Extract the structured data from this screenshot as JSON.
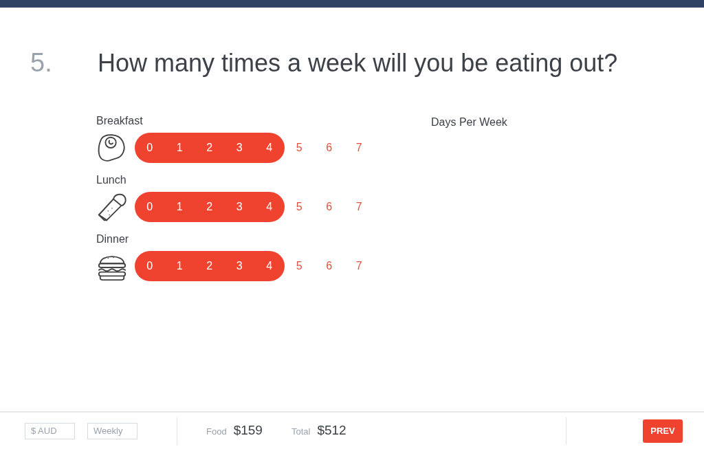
{
  "question": {
    "number": "5.",
    "text": "How many times a week will you be eating out?"
  },
  "column_heading": "Days Per Week",
  "meals": [
    {
      "kind": "egg",
      "label": "Breakfast",
      "options": [
        {
          "label": "0",
          "selected": false
        },
        {
          "label": "1",
          "selected": false
        },
        {
          "label": "2",
          "selected": false
        },
        {
          "label": "3",
          "selected": false
        },
        {
          "label": "4",
          "selected": true
        },
        {
          "label": "5",
          "selected": false
        },
        {
          "label": "6",
          "selected": false
        },
        {
          "label": "7",
          "selected": false
        }
      ]
    },
    {
      "kind": "burrito",
      "label": "Lunch",
      "options": [
        {
          "label": "0",
          "selected": false
        },
        {
          "label": "1",
          "selected": false
        },
        {
          "label": "2",
          "selected": false
        },
        {
          "label": "3",
          "selected": false
        },
        {
          "label": "4",
          "selected": true
        },
        {
          "label": "5",
          "selected": false
        },
        {
          "label": "6",
          "selected": false
        },
        {
          "label": "7",
          "selected": false
        }
      ]
    },
    {
      "kind": "burger",
      "label": "Dinner",
      "options": [
        {
          "label": "0",
          "selected": false
        },
        {
          "label": "1",
          "selected": false
        },
        {
          "label": "2",
          "selected": false
        },
        {
          "label": "3",
          "selected": false
        },
        {
          "label": "4",
          "selected": true
        },
        {
          "label": "5",
          "selected": false
        },
        {
          "label": "6",
          "selected": false
        },
        {
          "label": "7",
          "selected": false
        }
      ]
    }
  ],
  "footer": {
    "currency_field": {
      "placeholder": "$ AUD"
    },
    "period_field": {
      "placeholder": "Weekly"
    },
    "totals": [
      {
        "label": "Food",
        "value": "$159"
      },
      {
        "label": "Total",
        "value": "$512"
      }
    ],
    "prev_button": "PREV"
  }
}
